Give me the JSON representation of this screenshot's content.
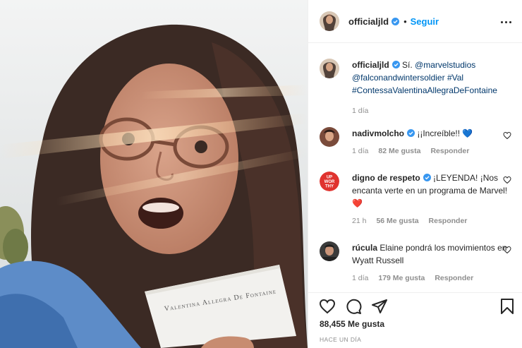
{
  "post": {
    "envelope_text": "Valentina Allegra De Fontaine",
    "author": "officialjld",
    "follow_label": "Seguir",
    "dot": "•",
    "caption": {
      "text_start": "Sí. ",
      "mention1": "@marvelstudios",
      "mention2": "@falconandwintersoldier",
      "hashtag1": "#Val",
      "hashtag2": "#ContessaValentinaAllegraDeFontaine",
      "time": "1 día"
    },
    "comments": [
      {
        "user": "nadivmolcho",
        "text": "¡¡Increíble!! 💙",
        "time": "1 día",
        "likes": "82 Me gusta",
        "reply": "Responder"
      },
      {
        "user": "digno de respeto",
        "text": "¡LEYENDA! ¡Nos encanta verte en un programa de Marvel! ❤️",
        "time": "21 h",
        "likes": "56 Me gusta",
        "reply": "Responder"
      },
      {
        "user": "rúcula",
        "text": "Elaine pondrá los movimientos en Wyatt Russell",
        "time": "1 día",
        "likes": "179 Me gusta",
        "reply": "Responder"
      }
    ],
    "like_count": "88,455 Me gusta",
    "timestamp": "HACE UN DÍA",
    "avatar2_text": [
      "UP",
      "WOR",
      "THY"
    ]
  },
  "colors": {
    "accent": "#0095f6",
    "link": "#00376b",
    "muted": "#8e8e8e"
  },
  "icons": [
    "verified-icon",
    "more-options-icon",
    "heart-icon",
    "comment-icon",
    "share-icon",
    "bookmark-icon"
  ]
}
